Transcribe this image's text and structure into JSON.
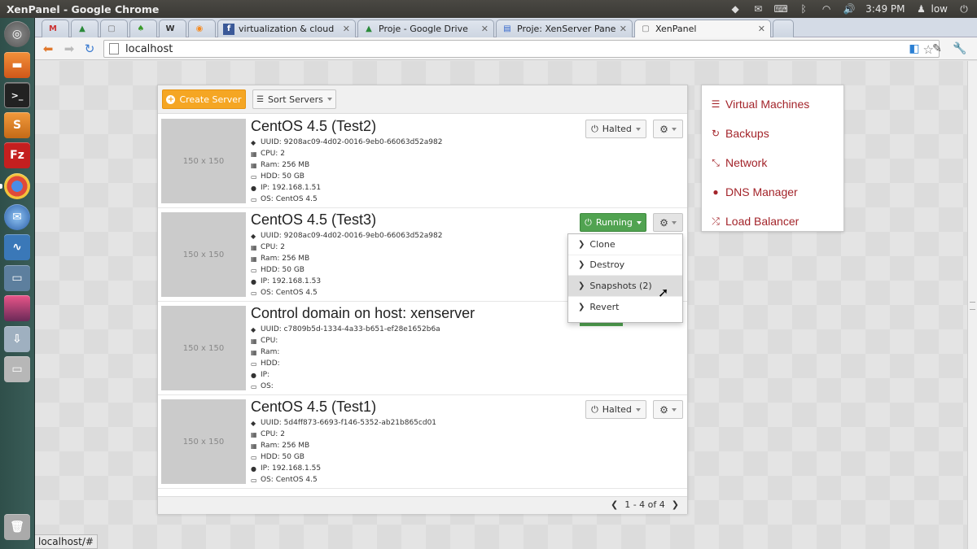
{
  "topbar": {
    "window_title": "XenPanel - Google Chrome",
    "clock": "3:49 PM",
    "user": "low"
  },
  "tabs": [
    {
      "title": "",
      "favicon": "gmail-icon",
      "fav": "M"
    },
    {
      "title": "",
      "favicon": "drive-icon",
      "fav": "▲"
    },
    {
      "title": "",
      "favicon": "page-icon",
      "fav": "▢"
    },
    {
      "title": "",
      "favicon": "leaf-icon",
      "fav": "♠"
    },
    {
      "title": "",
      "favicon": "wordpress-icon",
      "fav": "W"
    },
    {
      "title": "",
      "favicon": "rss-icon",
      "fav": "◉"
    },
    {
      "title": "virtualization & cloud",
      "favicon": "facebook-icon",
      "fav": "f"
    },
    {
      "title": "Proje - Google Drive",
      "favicon": "drive-icon",
      "fav": "▲"
    },
    {
      "title": "Proje: XenServer Panel - C",
      "favicon": "doc-icon",
      "fav": "▤"
    },
    {
      "title": "XenPanel",
      "favicon": "page-icon",
      "fav": "▢"
    }
  ],
  "omnibox": {
    "url": "localhost"
  },
  "toolbar": {
    "create_label": "Create Server",
    "sort_label": "Sort Servers"
  },
  "servers": [
    {
      "name": "CentOS 4.5 (Test2)",
      "thumb": "150 x 150",
      "uuid": "UUID: 9208ac09-4d02-0016-9eb0-66063d52a982",
      "cpu": "CPU: 2",
      "ram": "Ram: 256 MB",
      "hdd": "HDD: 50 GB",
      "ip": "IP: 192.168.1.51",
      "os": "OS: CentOS 4.5",
      "status": "Halted"
    },
    {
      "name": "CentOS 4.5 (Test3)",
      "thumb": "150 x 150",
      "uuid": "UUID: 9208ac09-4d02-0016-9eb0-66063d52a982",
      "cpu": "CPU: 2",
      "ram": "Ram: 256 MB",
      "hdd": "HDD: 50 GB",
      "ip": "IP: 192.168.1.53",
      "os": "OS: CentOS 4.5",
      "status": "Running"
    },
    {
      "name": "Control domain on host: xenserver",
      "thumb": "150 x 150",
      "uuid": "UUID: c7809b5d-1334-4a33-b651-ef28e1652b6a",
      "cpu": "CPU:",
      "ram": "Ram:",
      "hdd": "HDD:",
      "ip": "IP:",
      "os": "OS:",
      "status": ""
    },
    {
      "name": "CentOS 4.5 (Test1)",
      "thumb": "150 x 150",
      "uuid": "UUID: 5d4ff873-6693-f146-5352-ab21b865cd01",
      "cpu": "CPU: 2",
      "ram": "Ram: 256 MB",
      "hdd": "HDD: 50 GB",
      "ip": "IP: 192.168.1.55",
      "os": "OS: CentOS 4.5",
      "status": "Halted"
    }
  ],
  "dropdown": {
    "items": [
      "Clone",
      "Destroy",
      "Snapshots (2)",
      "Revert"
    ]
  },
  "pager": {
    "text": "1 - 4 of 4"
  },
  "sidemenu": {
    "items": [
      {
        "label": "Virtual Machines",
        "icon": "server-list-icon"
      },
      {
        "label": "Backups",
        "icon": "refresh-icon"
      },
      {
        "label": "Network",
        "icon": "network-icon"
      },
      {
        "label": "DNS Manager",
        "icon": "globe-icon"
      },
      {
        "label": "Load Balancer",
        "icon": "shuffle-icon"
      }
    ]
  },
  "statusbar": {
    "url": "localhost/#"
  },
  "colors": {
    "accent_orange": "#f5a623",
    "running_green": "#51a351",
    "menu_red": "#a3242a"
  }
}
